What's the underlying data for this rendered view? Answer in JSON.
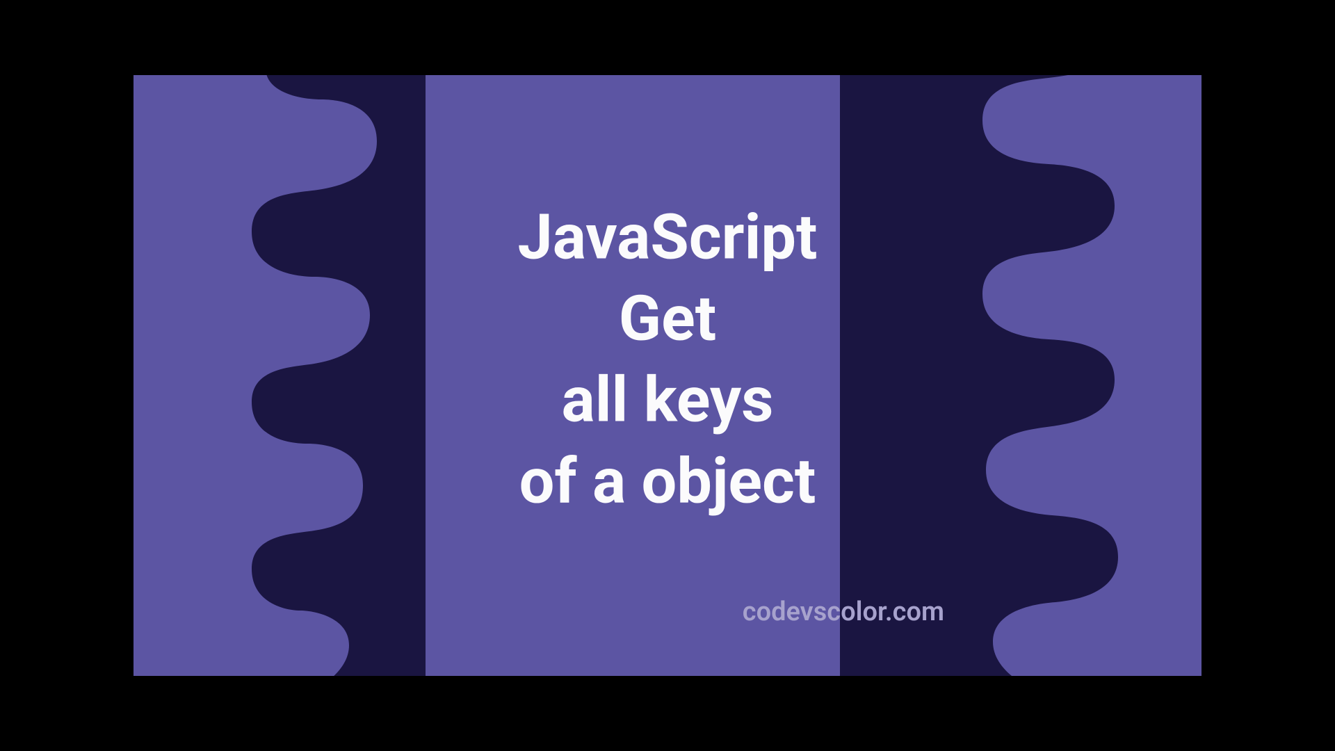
{
  "headline": {
    "line1": "JavaScript",
    "line2": "Get",
    "line3": "all keys",
    "line4": "of a object"
  },
  "watermark": "codevscolor.com",
  "colors": {
    "bg_outer": "#5c55a3",
    "bg_inner": "#1a1541",
    "text_main": "#fbfbfc",
    "text_watermark": "#a7a2cd"
  }
}
